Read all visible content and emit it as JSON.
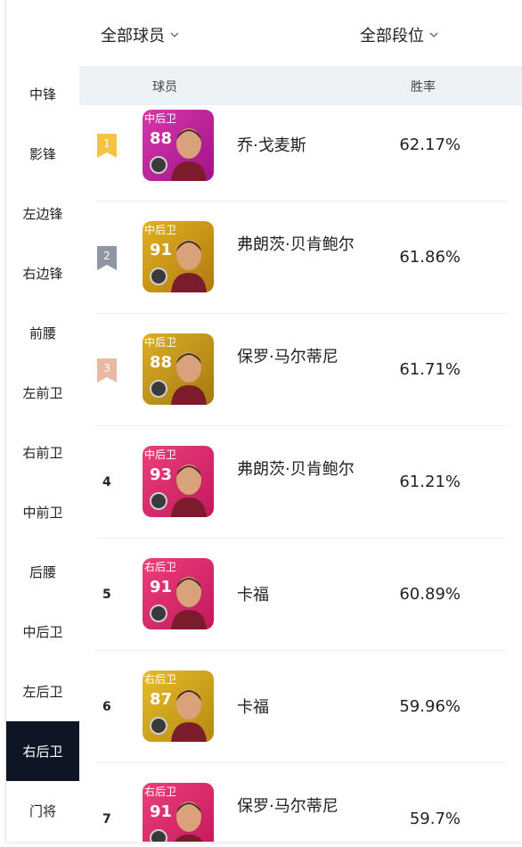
{
  "filters": {
    "player": "全部球员",
    "rank": "全部段位"
  },
  "sidebar": [
    {
      "label": "中锋",
      "active": false
    },
    {
      "label": "影锋",
      "active": false
    },
    {
      "label": "左边锋",
      "active": false
    },
    {
      "label": "右边锋",
      "active": false
    },
    {
      "label": "前腰",
      "active": false
    },
    {
      "label": "左前卫",
      "active": false
    },
    {
      "label": "右前卫",
      "active": false
    },
    {
      "label": "中前卫",
      "active": false
    },
    {
      "label": "后腰",
      "active": false
    },
    {
      "label": "中后卫",
      "active": false
    },
    {
      "label": "左后卫",
      "active": false
    },
    {
      "label": "右后卫",
      "active": true
    },
    {
      "label": "门将",
      "active": false
    }
  ],
  "table": {
    "col_player": "球员",
    "col_winrate": "胜率"
  },
  "rows": [
    {
      "rank": "1",
      "position": "中后卫",
      "rating": "88",
      "name": "乔·戈麦斯",
      "winrate": "62.17%",
      "card_color": "#a0118c",
      "card_color2": "#d63aa8",
      "flag_color": "#f6c244"
    },
    {
      "rank": "2",
      "position": "中后卫",
      "rating": "91",
      "name": "弗朗茨·贝肯鲍尔",
      "winrate": "61.86%",
      "card_color": "#b07a10",
      "card_color2": "#e2b021",
      "flag_color": "#8f97a5"
    },
    {
      "rank": "3",
      "position": "中后卫",
      "rating": "88",
      "name": "保罗·马尔蒂尼",
      "winrate": "61.71%",
      "card_color": "#a37a12",
      "card_color2": "#dcae24",
      "flag_color": "#e8b9a3"
    },
    {
      "rank": "4",
      "position": "中后卫",
      "rating": "93",
      "name": "弗朗茨·贝肯鲍尔",
      "winrate": "61.21%",
      "card_color": "#c2185b",
      "card_color2": "#ec407a",
      "flag_color": ""
    },
    {
      "rank": "5",
      "position": "右后卫",
      "rating": "91",
      "name": "卡福",
      "winrate": "60.89%",
      "card_color": "#c2185b",
      "card_color2": "#ec407a",
      "flag_color": ""
    },
    {
      "rank": "6",
      "position": "右后卫",
      "rating": "87",
      "name": "卡福",
      "winrate": "59.96%",
      "card_color": "#b58a10",
      "card_color2": "#e5bc2a",
      "flag_color": ""
    },
    {
      "rank": "7",
      "position": "右后卫",
      "rating": "91",
      "name": "保罗·马尔蒂尼",
      "winrate": "59.7%",
      "card_color": "#c2185b",
      "card_color2": "#ec407a",
      "flag_color": ""
    }
  ]
}
